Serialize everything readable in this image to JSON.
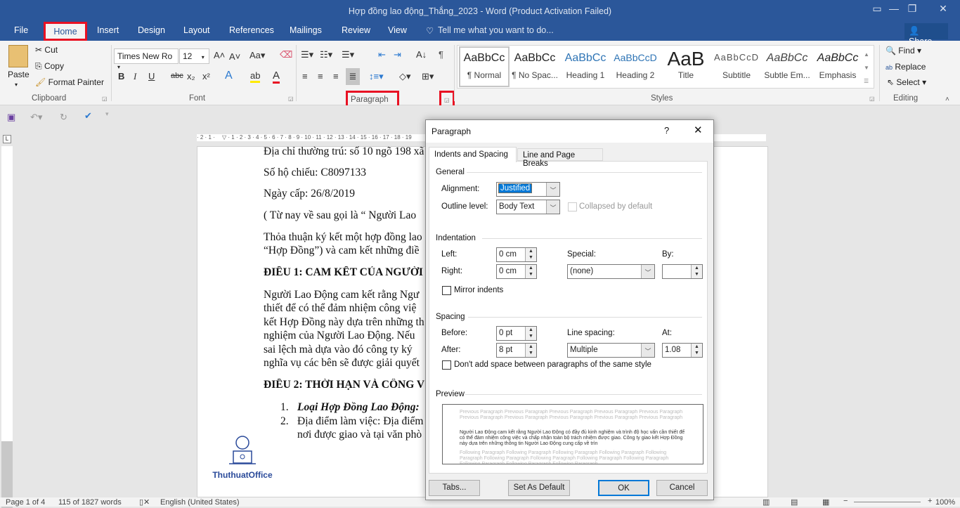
{
  "window": {
    "title": "Hợp đồng lao động_Thắng_2023 - Word (Product Activation Failed)",
    "share": "Share"
  },
  "tabs": [
    "File",
    "Home",
    "Insert",
    "Design",
    "Layout",
    "References",
    "Mailings",
    "Review",
    "View"
  ],
  "tell_me": "Tell me what you want to do...",
  "clipboard": {
    "paste": "Paste",
    "cut": "Cut",
    "copy": "Copy",
    "format_painter": "Format Painter",
    "label": "Clipboard"
  },
  "font": {
    "name": "Times New Ro",
    "size": "12",
    "label": "Font",
    "case": "Aa"
  },
  "paragraph": {
    "label": "Paragraph"
  },
  "styles": {
    "label": "Styles",
    "items": [
      {
        "sample": "AaBbCc",
        "name": "¶ Normal"
      },
      {
        "sample": "AaBbCc",
        "name": "¶ No Spac..."
      },
      {
        "sample": "AaBbCc",
        "name": "Heading 1"
      },
      {
        "sample": "AaBbCcD",
        "name": "Heading 2"
      },
      {
        "sample": "AaB",
        "name": "Title"
      },
      {
        "sample": "AaBbCcD",
        "name": "Subtitle"
      },
      {
        "sample": "AaBbCc",
        "name": "Subtle Em..."
      },
      {
        "sample": "AaBbCc",
        "name": "Emphasis"
      }
    ]
  },
  "editing": {
    "find": "Find",
    "replace": "Replace",
    "select": "Select",
    "label": "Editing"
  },
  "document": {
    "lines": [
      "Địa chỉ thường trú: số 10 ngõ 198 xã",
      "Số hộ chiếu: C8097133",
      "Ngày cấp: 26/8/2019",
      " ( Từ nay về sau gọi là “ Người Lao",
      "Thỏa thuận ký kết một hợp đồng lao",
      "“Hợp Đồng”) và cam kết những điề",
      "ĐIỀU 1: CAM KẾT CỦA NGƯỜI",
      "Người Lao Động cam kết rằng Ngư",
      "thiết để có thể đảm nhiệm công việ",
      "kết Hợp Đồng này dựa trên những th",
      "nghiệm của Người Lao Động. Nếu",
      "sai lệch mà dựa vào đó công ty ký",
      "nghĩa vụ các bên sẽ được giải quyết",
      "ĐIỀU 2: THỜI HẠN VÀ CÔNG V",
      "Loại Hợp Đồng Lao Động:",
      "Địa điểm làm việc: Địa điểm",
      "nơi được giao và tại văn phò"
    ],
    "list_nums": [
      "1.",
      "2."
    ],
    "logo": "ThuthuatOffice"
  },
  "status": {
    "page": "Page 1 of 4",
    "words": "115 of 1827 words",
    "language": "English (United States)",
    "zoom": "100%"
  },
  "dialog": {
    "title": "Paragraph",
    "help": "?",
    "tabs": [
      "Indents and Spacing",
      "Line and Page Breaks"
    ],
    "general": "General",
    "alignment_label": "Alignment:",
    "alignment": "Justified",
    "outline_label": "Outline level:",
    "outline": "Body Text",
    "collapsed": "Collapsed by default",
    "indentation": "Indentation",
    "left_label": "Left:",
    "left": "0 cm",
    "right_label": "Right:",
    "right": "0 cm",
    "special_label": "Special:",
    "special": "(none)",
    "by_label": "By:",
    "by": "",
    "mirror": "Mirror indents",
    "spacing": "Spacing",
    "before_label": "Before:",
    "before": "0 pt",
    "after_label": "After:",
    "after": "8 pt",
    "line_spacing_label": "Line spacing:",
    "line_spacing": "Multiple",
    "at_label": "At:",
    "at": "1.08",
    "dont_add": "Don't add space between paragraphs of the same style",
    "preview": "Preview",
    "preview_prev": "Previous Paragraph Previous Paragraph Previous Paragraph Previous Paragraph Previous Paragraph Previous Paragraph Previous Paragraph Previous Paragraph Previous Paragraph Previous Paragraph",
    "preview_text": "Người Lao Động cam kết rằng Người Lao Động có đầy đủ kinh nghiệm và trình độ học vấn cần thiết để có thể đảm nhiệm công việc và chấp nhận toàn bộ trách nhiệm được giao. Công ty giao kết Hợp Đồng này dựa trên những thông tin Người Lao Động cung cấp về trìn",
    "preview_next": "Following Paragraph Following Paragraph Following Paragraph Following Paragraph Following Paragraph Following Paragraph Following Paragraph Following Paragraph Following Paragraph Following Paragraph Following Paragraph Following Paragraph",
    "tabs_btn": "Tabs...",
    "default_btn": "Set As Default",
    "ok": "OK",
    "cancel": "Cancel"
  },
  "colors": {
    "accent": "#2b579a",
    "highlight_box": "#e81123",
    "selection": "#0078d7"
  }
}
